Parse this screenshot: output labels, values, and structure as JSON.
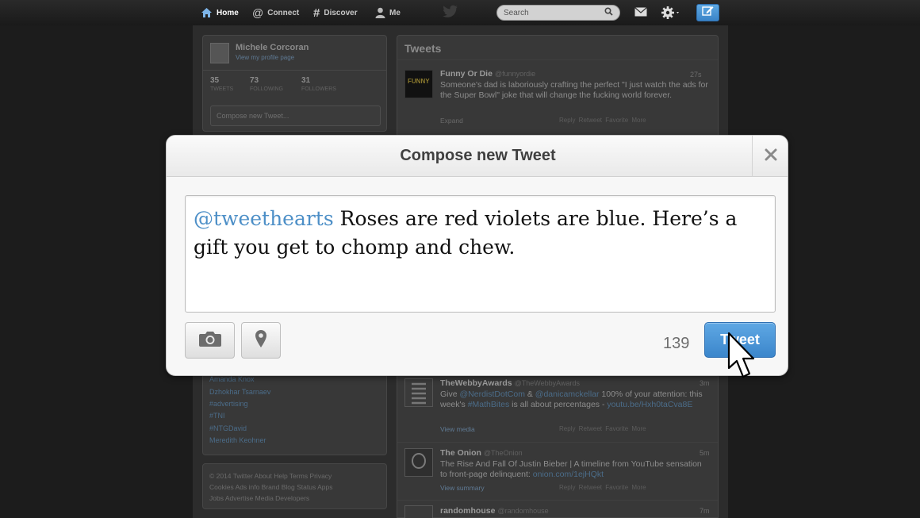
{
  "topbar": {
    "nav": [
      {
        "label": "Home",
        "icon": "home-icon",
        "active": true
      },
      {
        "label": "Connect",
        "icon": "at-icon",
        "active": false
      },
      {
        "label": "Discover",
        "icon": "hash-icon",
        "active": false
      },
      {
        "label": "Me",
        "icon": "person-icon",
        "active": false
      }
    ],
    "search_placeholder": "Search"
  },
  "profile": {
    "name": "Michele Corcoran",
    "link": "View my profile page",
    "stats": [
      {
        "value": "35",
        "label": "TWEETS"
      },
      {
        "value": "73",
        "label": "FOLLOWING"
      },
      {
        "value": "31",
        "label": "FOLLOWERS"
      }
    ],
    "compose_placeholder": "Compose new Tweet..."
  },
  "trends": [
    "Amanda Knox",
    "Dzhokhar Tsarnaev",
    "#advertising",
    "#TNI",
    "#NTGDavid",
    "Meredith Keohner"
  ],
  "footer": [
    "© 2014 Twitter  About  Help  Terms  Privacy",
    "Cookies  Ads info  Brand  Blog  Status  Apps",
    "Jobs  Advertise  Media  Developers"
  ],
  "timeline": {
    "heading": "Tweets",
    "tweets": [
      {
        "name": "Funny Or Die",
        "handle": "@funnyordie",
        "time": "27s",
        "text": "Someone's dad is laboriously crafting the perfect \"I just watch the ads for the Super Bowl\" joke that will change the fucking world forever.",
        "meta": "Expand",
        "actions": "Reply  Retweet  Favorite  More"
      },
      {
        "name": "TheWebbyAwards",
        "handle": "@TheWebbyAwards",
        "time": "3m",
        "text_parts": [
          "Give ",
          "@NerdistDotCom",
          " & ",
          "@danicamckellar",
          " 100% of your attention: this week's ",
          "#MathBites",
          " is all about percentages - ",
          "youtu.be/Hxh0taCva8E"
        ],
        "meta": "View media",
        "actions": "Reply  Retweet  Favorite  More"
      },
      {
        "name": "The Onion",
        "handle": "@TheOnion",
        "time": "5m",
        "text_parts": [
          "The Rise And Fall Of Justin Bieber | A timeline from YouTube sensation to front-page delinquent: ",
          "onion.com/1ejHQkt"
        ],
        "meta": "View summary",
        "actions": "Reply  Retweet  Favorite  More"
      },
      {
        "name": "randomhouse",
        "handle": "@randomhouse",
        "time": "7m"
      }
    ]
  },
  "modal": {
    "title": "Compose new Tweet",
    "mention": "@tweethearts",
    "body": " Roses are red violets are blue. Here’s a gift you get to chomp and chew.",
    "char_count": "139",
    "tweet_label": "Tweet"
  },
  "colors": {
    "accent": "#4d8fc7",
    "tweet_button": "#3b86cb"
  }
}
